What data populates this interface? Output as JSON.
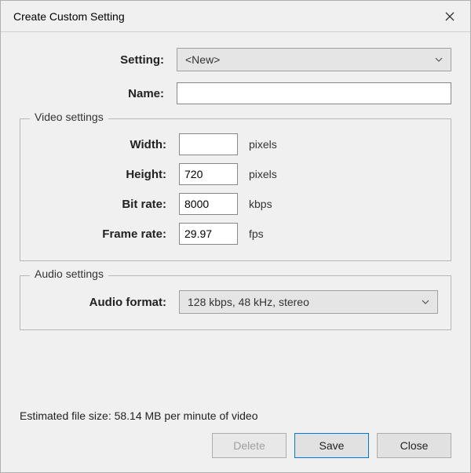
{
  "titlebar": {
    "title": "Create Custom Setting"
  },
  "form": {
    "setting_label": "Setting:",
    "setting_value": "<New>",
    "name_label": "Name:",
    "name_value": ""
  },
  "video": {
    "legend": "Video settings",
    "width_label": "Width:",
    "width_value": "",
    "width_unit": "pixels",
    "height_label": "Height:",
    "height_value": "720",
    "height_unit": "pixels",
    "bitrate_label": "Bit rate:",
    "bitrate_value": "8000",
    "bitrate_unit": "kbps",
    "framerate_label": "Frame rate:",
    "framerate_value": "29.97",
    "framerate_unit": "fps"
  },
  "audio": {
    "legend": "Audio settings",
    "format_label": "Audio format:",
    "format_value": "128 kbps, 48 kHz, stereo"
  },
  "footer": {
    "estimate": "Estimated file size: 58.14 MB per minute of video",
    "delete_label": "Delete",
    "save_label": "Save",
    "close_label": "Close"
  }
}
